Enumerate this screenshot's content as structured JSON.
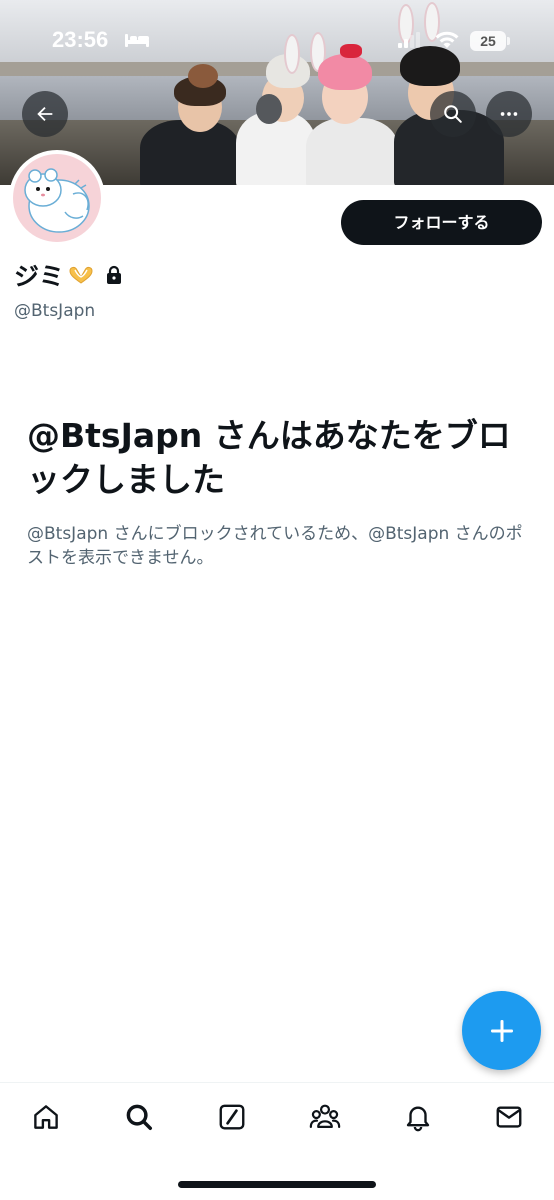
{
  "status_bar": {
    "time": "23:56",
    "battery": "25"
  },
  "profile": {
    "display_name": "ジミ",
    "handle": "@BtsJapn",
    "follow_label": "フォローする"
  },
  "blocked_notice": {
    "title": "@BtsJapn さんはあなたをブロックしました",
    "description": "@BtsJapn さんにブロックされているため、@BtsJapn さんのポストを表示できません。"
  },
  "icons": {
    "back": "arrow-left-icon",
    "search": "search-icon",
    "more": "more-horizontal-icon",
    "compose": "plus-icon",
    "nav": [
      "home-icon",
      "search-icon",
      "grok-icon",
      "communities-icon",
      "bell-icon",
      "mail-icon"
    ]
  },
  "colors": {
    "accent": "#1d9bf0",
    "primary_text": "#0f1419",
    "secondary_text": "#536471",
    "follow_button": "#0f1419"
  }
}
